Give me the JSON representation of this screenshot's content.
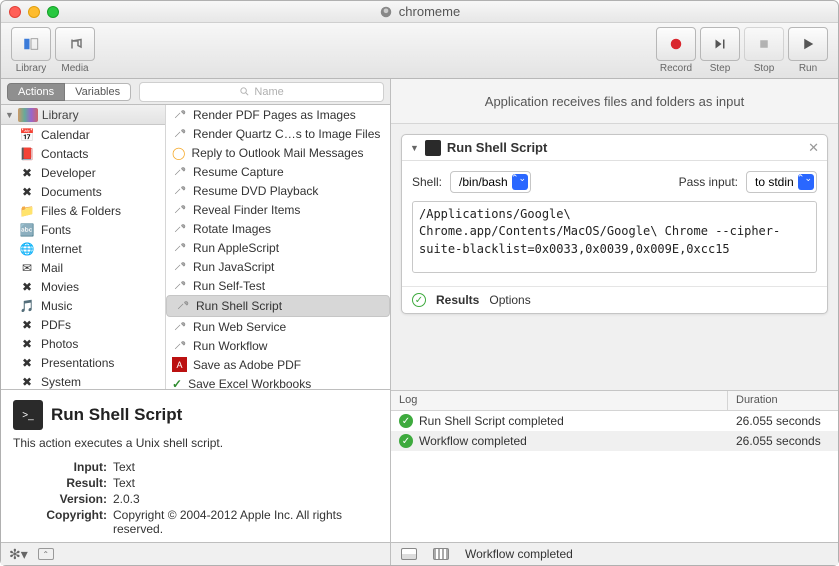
{
  "window": {
    "title": "chromeme"
  },
  "toolbar": {
    "left": [
      {
        "label": "Library",
        "icon": "library-icon"
      },
      {
        "label": "Media",
        "icon": "media-icon"
      }
    ],
    "right": [
      {
        "label": "Record",
        "icon": "record-icon"
      },
      {
        "label": "Step",
        "icon": "step-icon"
      },
      {
        "label": "Stop",
        "icon": "stop-icon",
        "disabled": true
      },
      {
        "label": "Run",
        "icon": "run-icon"
      }
    ]
  },
  "segmented": {
    "items": [
      "Actions",
      "Variables"
    ],
    "active": 0
  },
  "search": {
    "placeholder": "Name"
  },
  "library": {
    "header": "Library",
    "categories": [
      "Calendar",
      "Contacts",
      "Developer",
      "Documents",
      "Files & Folders",
      "Fonts",
      "Internet",
      "Mail",
      "Movies",
      "Music",
      "PDFs",
      "Photos",
      "Presentations",
      "System"
    ],
    "actions": [
      "Render PDF Pages as Images",
      "Render Quartz C…s to Image Files",
      "Reply to Outlook Mail Messages",
      "Resume Capture",
      "Resume DVD Playback",
      "Reveal Finder Items",
      "Rotate Images",
      "Run AppleScript",
      "Run JavaScript",
      "Run Self-Test",
      "Run Shell Script",
      "Run Web Service",
      "Run Workflow",
      "Save as Adobe PDF",
      "Save Excel Workbooks"
    ],
    "selected_action": "Run Shell Script"
  },
  "description": {
    "title": "Run Shell Script",
    "text": "This action executes a Unix shell script.",
    "rows": {
      "Input": "Text",
      "Result": "Text",
      "Version": "2.0.3",
      "Copyright": "Copyright © 2004-2012 Apple Inc.  All rights reserved."
    }
  },
  "receives": "Application receives files and folders as input",
  "action_card": {
    "title": "Run Shell Script",
    "shell_label": "Shell:",
    "shell_value": "/bin/bash",
    "pass_label": "Pass input:",
    "pass_value": "to stdin",
    "script": "/Applications/Google\\ Chrome.app/Contents/MacOS/Google\\ Chrome --cipher-suite-blacklist=0x0033,0x0039,0x009E,0xcc15",
    "results": "Results",
    "options": "Options"
  },
  "log": {
    "headers": {
      "log": "Log",
      "duration": "Duration"
    },
    "rows": [
      {
        "msg": "Run Shell Script completed",
        "dur": "26.055 seconds"
      },
      {
        "msg": "Workflow completed",
        "dur": "26.055 seconds"
      }
    ]
  },
  "status": {
    "text": "Workflow completed"
  }
}
